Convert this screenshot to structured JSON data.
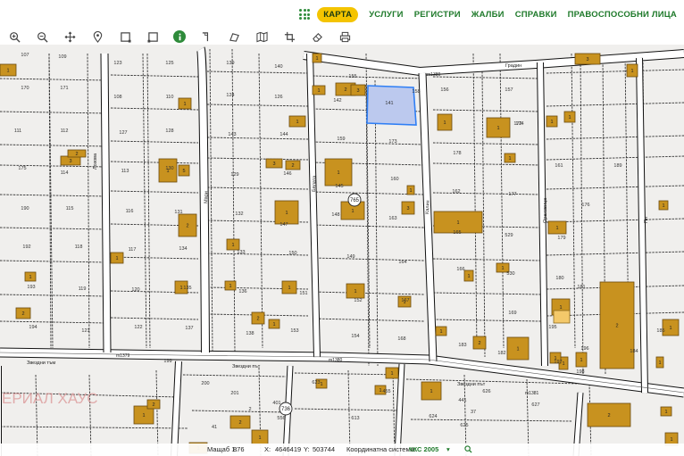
{
  "nav": {
    "items": [
      "КАРТА",
      "УСЛУГИ",
      "РЕГИСТРИ",
      "ЖАЛБИ",
      "СПРАВКИ",
      "ПРАВОСПОСОБНИ ЛИЦА"
    ],
    "active": 0
  },
  "toolbar": {
    "tools": [
      "zoom-in-icon",
      "zoom-out-icon",
      "pan-icon",
      "locate-pin-icon",
      "select-rect-icon",
      "select-rect-alt-icon",
      "info-icon",
      "measure-angle-icon",
      "measure-area-icon",
      "map-layers-icon",
      "crop-icon",
      "eraser-icon",
      "print-icon"
    ]
  },
  "map": {
    "streets": [
      {
        "label": "Градин",
        "name": "street-gradina"
      },
      {
        "label": "Звездни тъм",
        "name": "street-zvezdni-1"
      },
      {
        "label": "Звездни път",
        "name": "street-zvezdni-2"
      },
      {
        "label": "Звездни път",
        "name": "street-zvezdni-3"
      },
      {
        "label": "Лозова",
        "name": "street-lozova"
      },
      {
        "label": "Мари",
        "name": "street-mari"
      },
      {
        "label": "Бялата",
        "name": "street-byalata"
      },
      {
        "label": "Калин",
        "name": "street-kalin"
      },
      {
        "label": "Ореховица",
        "name": "street-orehovitsa"
      },
      {
        "label": "Пл",
        "name": "street-pl"
      }
    ],
    "watermark": "ЕРИАЛ ХАУС",
    "road_ids": [
      "m1380",
      "m1379",
      "m1381",
      "m1380"
    ],
    "badges": [
      "765",
      "736"
    ],
    "selected_parcel": "157",
    "parcel_numbers": [
      "107",
      "109",
      "123",
      "125",
      "139",
      "140",
      "155",
      "156",
      "157",
      "170",
      "171",
      "108",
      "110",
      "124",
      "126",
      "142",
      "141",
      "158",
      "172",
      "111",
      "112",
      "127",
      "128",
      "143",
      "144",
      "159",
      "173",
      "174",
      "175",
      "114",
      "113",
      "130",
      "129",
      "146",
      "145",
      "160",
      "161",
      "189",
      "190",
      "115",
      "116",
      "131",
      "132",
      "147",
      "148",
      "163",
      "162",
      "177",
      "178",
      "176",
      "192",
      "118",
      "117",
      "134",
      "133",
      "150",
      "149",
      "164",
      "165",
      "529",
      "179",
      "193",
      "119",
      "120",
      "135",
      "136",
      "151",
      "152",
      "167",
      "166",
      "530",
      "180",
      "194",
      "121",
      "122",
      "137",
      "138",
      "153",
      "154",
      "168",
      "169",
      "181",
      "195",
      "196",
      "197",
      "198",
      "183",
      "182",
      "184",
      "185",
      "199",
      "200",
      "201",
      "401",
      "623",
      "455",
      "441",
      "37",
      "41",
      "2",
      "556",
      "613",
      "624",
      "625",
      "626",
      "627",
      "628",
      "629"
    ],
    "building_labels": [
      "1",
      "2",
      "3",
      "4",
      "5"
    ]
  },
  "status": {
    "scale_label": "Мащаб 1:",
    "scale_value": "876",
    "x_label": "X:",
    "x_value": "4646419",
    "y_label": "Y:",
    "y_value": "503744",
    "crs_label": "Координатна система:",
    "crs_value": "ККС 2005"
  },
  "colors": {
    "nav_green": "#1f7a2b",
    "nav_active_bg": "#f4c400",
    "building_fill": "#c8921f",
    "building_stroke": "#6b4a0e",
    "parcel_bg": "#f0efed",
    "selection_fill": "#bcc9ee",
    "selection_stroke": "#2f7ff5",
    "watermark": "#d98f8f"
  }
}
